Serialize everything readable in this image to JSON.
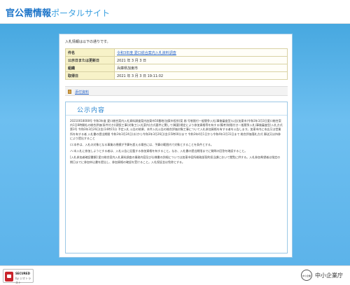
{
  "header": {
    "logo_main": "官公需情報",
    "logo_sub": "ポータルサイト"
  },
  "intro": "入札情報は以下の通りです。",
  "info_rows": [
    {
      "key": "件名",
      "value": "令和3年度 愛口総合案内入札資料調査"
    },
    {
      "key": "公示日または更新日",
      "value": "2021 年 3 月 3 日"
    },
    {
      "key": "組織",
      "value": "兵庫県加東市"
    },
    {
      "key": "取得日",
      "value": "2021 年 3 月 3 日 19:11:02"
    }
  ],
  "attachment": {
    "label": "添付資料"
  },
  "notice": {
    "title": "公示内容",
    "paragraphs": [
      "20210018008号 令和3年度 愛口総合案内入札資料調査案内加東市50番地(加東市役所)案 務 号制限付一般競争入札(事後審査型)公告(加東市)令和3年3月3日愛口総合案内1日8時開札の総合評価(条件付き)(建設工事)対象工(入札案内)方式要件に関して(概要)規定により参加資格等を有する(備考)制限付き一般競争入札(事後審査型)入札方式第3号 令和3年3月26日(金)14時15分 予定入札 公告の結果、本件入札公告の総合評価対象工事について入札参加資格を有する者を公告します。加東市内に本店又は営業所を有する者 入札書の提出期間 令和3年3月24日(水)から令和3年3月26日(金)15時00分まで 令和3年4月1日から令和4年3月31日まで 総合評価落札方式 郵送又は持参により提出すること",
      "ロ:本件は、入札の対象となる事業の規模が予算を超える場合には、予算の範囲内で対象とすることを条件とする。",
      "ハ:本入札に参加しようとする者は、入札公告に記載する参加資格を有すること。なお、入札書の提出期限までに質問の回答を確認すること。",
      "[入札参加者確認書類]:愛口総合案内入札資料調査の業務内容及び仕様書の詳細については加東市役所総務部契約担当課において閲覧に供する。入札参加希望者は指定の期日までに参加申込書を提出し、参加資格の確認を受けること。入札保証金は免除とする。"
    ]
  },
  "footer": {
    "seal_line1": "SECURED",
    "seal_line2": "by ジオトラスト",
    "emblem_text": "中小企業庁",
    "agency_name": "中小企業庁"
  },
  "colors": {
    "brand_blue": "#1a73c8",
    "background_blue": "#5cb3ea",
    "table_key_bg": "#f7f2c8",
    "link": "#2563c9"
  }
}
